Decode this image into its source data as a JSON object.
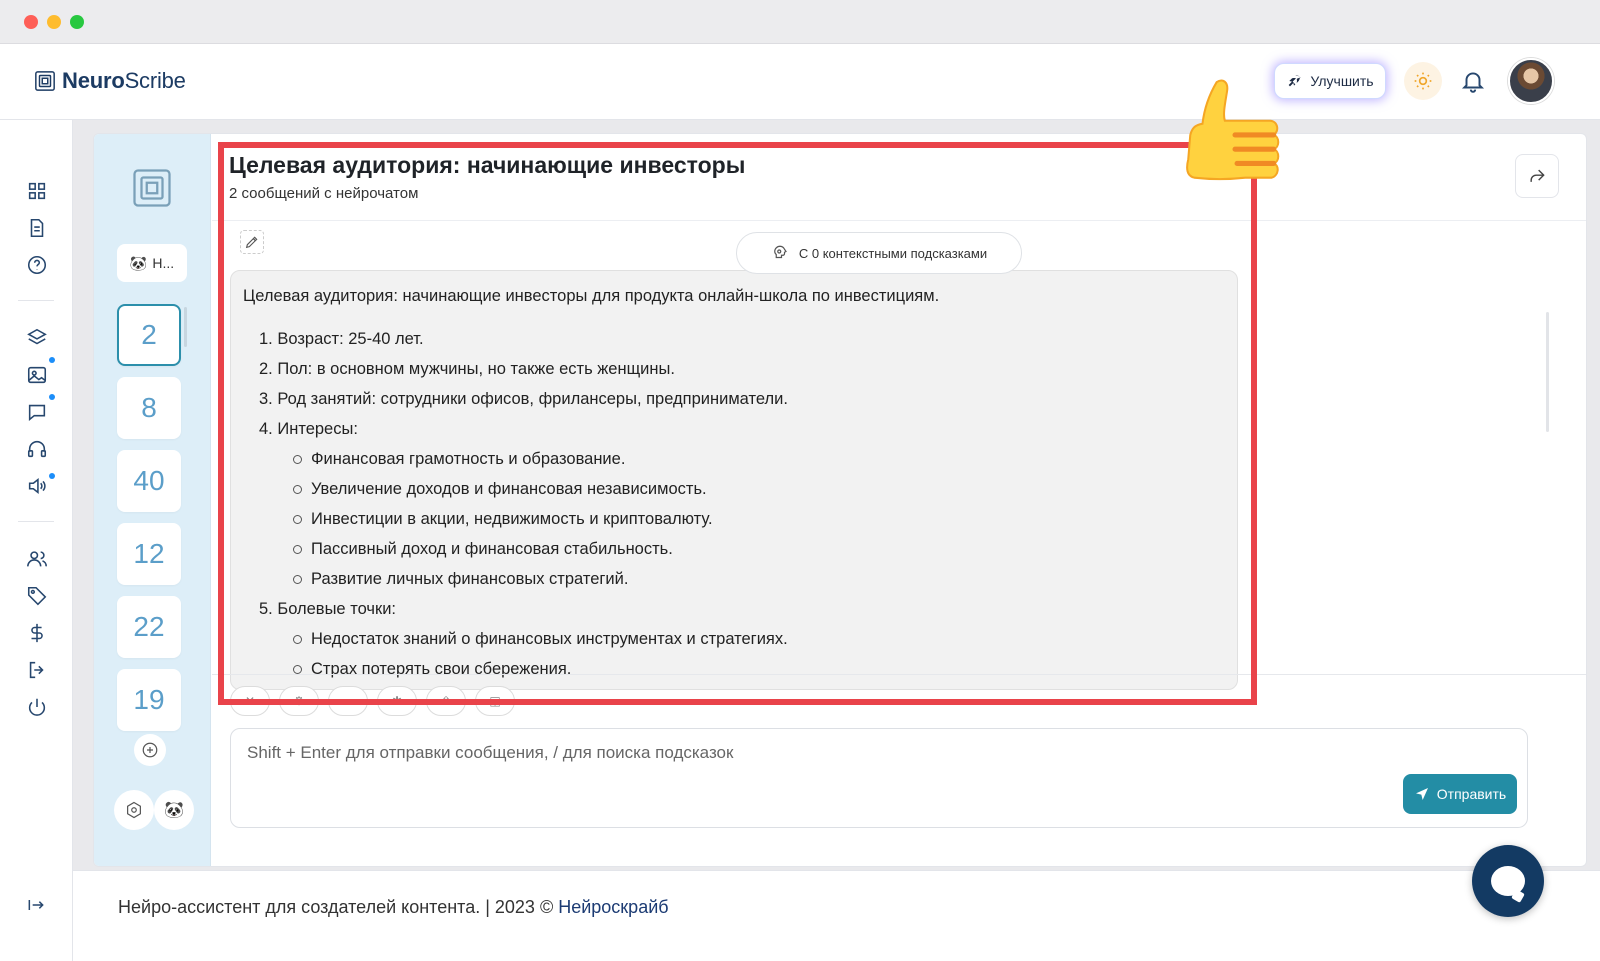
{
  "brand": {
    "name_bold": "Neuro",
    "name_rest": "Scribe"
  },
  "header": {
    "upgrade_label": "Улучшить"
  },
  "chat_list": {
    "current_name": "Н...",
    "items": [
      "2",
      "8",
      "40",
      "12",
      "22",
      "19"
    ],
    "active_index": 0
  },
  "chat": {
    "title": "Целевая аудитория: начинающие инвесторы",
    "subtitle": "2 сообщений с нейрочатом",
    "context_pill": "С 0 контекстными подсказками",
    "message": {
      "intro": "Целевая аудитория: начинающие инвесторы для продукта онлайн-школа по инвестициям.",
      "items": [
        {
          "num": "1.",
          "text": "Возраст: 25-40 лет."
        },
        {
          "num": "2.",
          "text": "Пол: в основном мужчины, но также есть женщины."
        },
        {
          "num": "3.",
          "text": "Род занятий: сотрудники офисов, фрилансеры, предприниматели."
        },
        {
          "num": "4.",
          "text": "Интересы:"
        },
        {
          "num": "5.",
          "text": "Болевые точки:"
        }
      ],
      "interests": [
        "Финансовая грамотность и образование.",
        "Увеличение доходов и финансовая независимость.",
        "Инвестиции в акции, недвижимость и криптовалюту.",
        "Пассивный доход и финансовая стабильность.",
        "Развитие личных финансовых стратегий."
      ],
      "pains": [
        "Недостаток знаний о финансовых инструментах и стратегиях.",
        "Страх потерять свои сбережения."
      ]
    },
    "composer_placeholder": "Shift + Enter для отправки сообщения, / для поиска подсказок",
    "send_label": "Отправить"
  },
  "footer": {
    "text": "Нейро-ассистент для создателей контента.  | 2023 © ",
    "link": "Нейроскрайб"
  },
  "colors": {
    "accent": "#238da5",
    "annotation": "#e9434a",
    "brand": "#1c3b63"
  },
  "icons": {
    "sidebar": [
      "grid-icon",
      "document-icon",
      "help-icon",
      "layers-icon",
      "image-icon",
      "chat-icon",
      "headphones-icon",
      "speaker-icon",
      "users-icon",
      "tag-icon",
      "dollar-icon",
      "logout-icon",
      "power-icon"
    ]
  }
}
